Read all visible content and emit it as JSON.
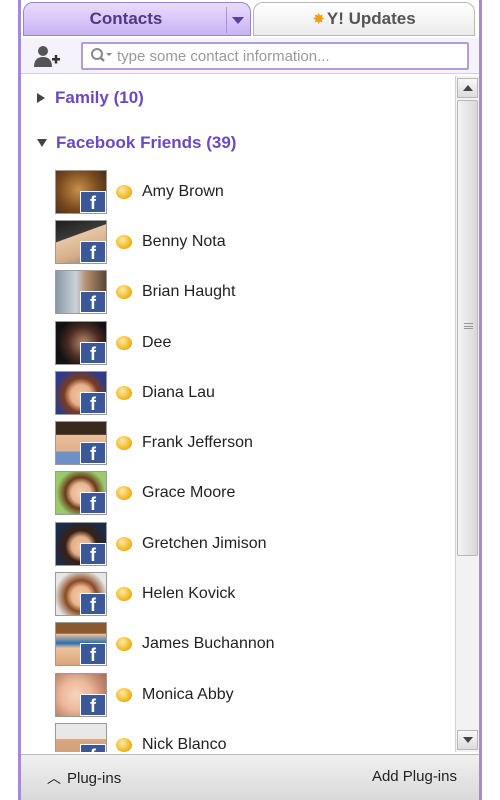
{
  "tabs": {
    "contacts_label": "Contacts",
    "updates_label": "Y! Updates"
  },
  "search": {
    "placeholder": "type some contact information..."
  },
  "groups": [
    {
      "label": "Family (10)",
      "expanded": false
    },
    {
      "label": "Facebook Friends (39)",
      "expanded": true
    }
  ],
  "contacts": [
    {
      "name": "Amy Brown",
      "status": "online"
    },
    {
      "name": "Benny Nota",
      "status": "online"
    },
    {
      "name": "Brian Haught",
      "status": "online"
    },
    {
      "name": "Dee",
      "status": "online"
    },
    {
      "name": "Diana Lau",
      "status": "online"
    },
    {
      "name": "Frank Jefferson",
      "status": "online"
    },
    {
      "name": "Grace Moore",
      "status": "online"
    },
    {
      "name": "Gretchen Jimison",
      "status": "online"
    },
    {
      "name": "Helen Kovick",
      "status": "online"
    },
    {
      "name": "James Buchannon",
      "status": "online"
    },
    {
      "name": "Monica Abby",
      "status": "online"
    },
    {
      "name": "Nick Blanco",
      "status": "online"
    }
  ],
  "badge_letter": "f",
  "bottom": {
    "plugins_label": "Plug-ins",
    "add_plugins_label": "Add Plug-ins"
  },
  "colors": {
    "accent": "#6b48c4",
    "facebook": "#3b5998",
    "status_online": "#f2b824"
  }
}
